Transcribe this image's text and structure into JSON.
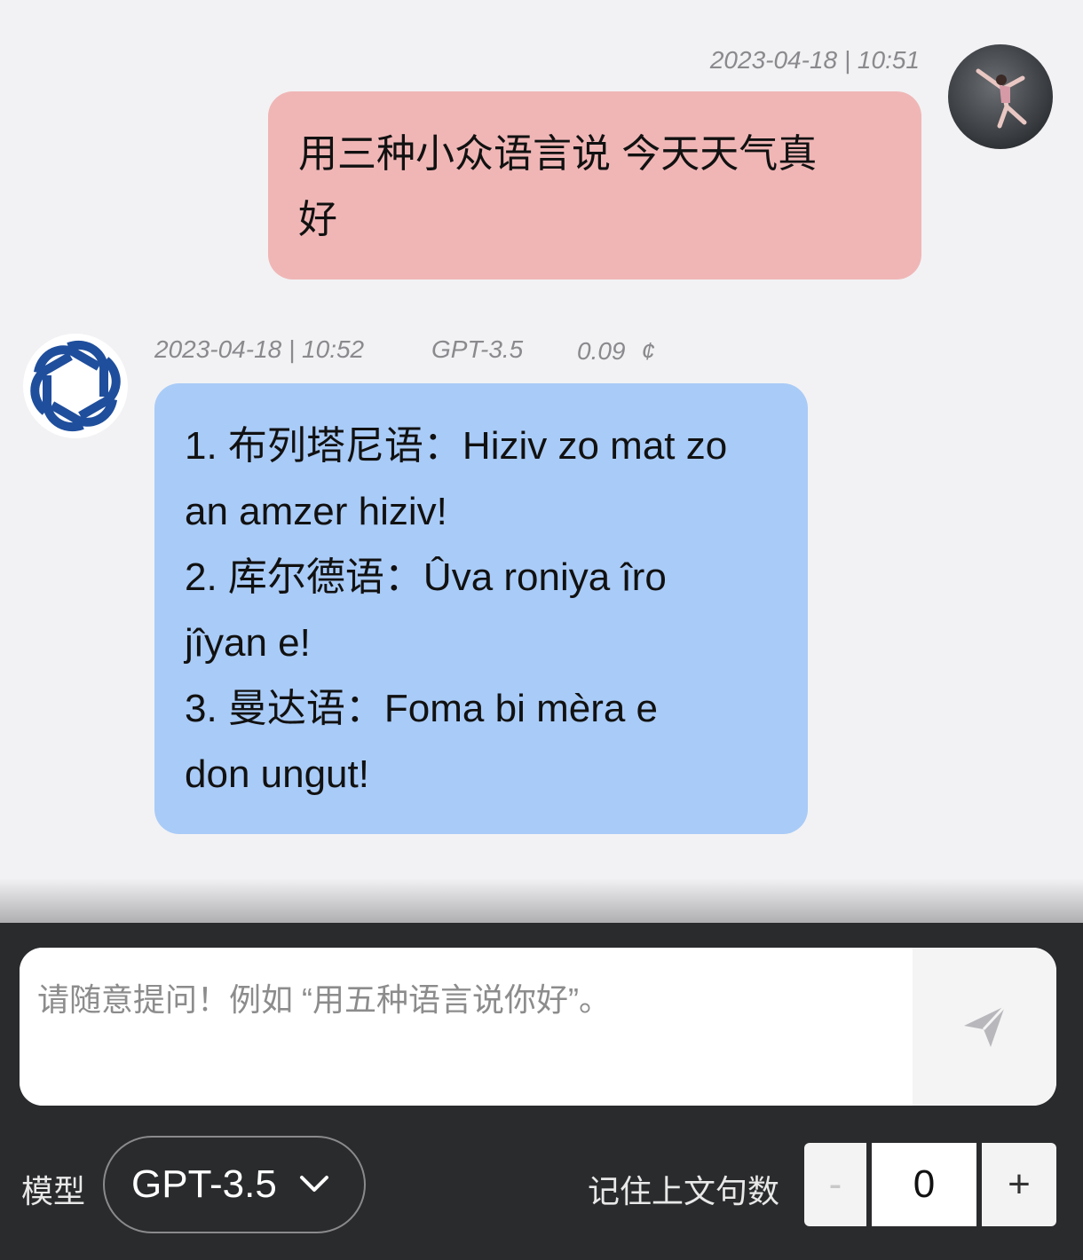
{
  "user_message": {
    "timestamp": "2023-04-18 | 10:51",
    "text": "用三种小众语言说 今天天气真\n好"
  },
  "bot_message": {
    "timestamp": "2023-04-18 | 10:52",
    "model": "GPT-3.5",
    "cost": "0.09",
    "cost_unit": "¢",
    "text": "1. 布列塔尼语：Hiziv zo mat zo\nan amzer hiziv!\n2. 库尔德语：Ûva roniya îro\njîyan e!\n3. 曼达语：Foma bi mèra e\ndon ungut!"
  },
  "input": {
    "placeholder": "请随意提问！例如 “用五种语言说你好”。",
    "value": ""
  },
  "controls": {
    "model_label": "模型",
    "model_selected": "GPT-3.5",
    "context_label": "记住上文句数",
    "context_count": "0",
    "minus_label": "-",
    "plus_label": "+"
  },
  "colors": {
    "user_bubble": "#f0b6b6",
    "bot_bubble": "#a9cbf7",
    "bottom_bar": "#2a2b2d",
    "bot_logo": "#1f4e9c"
  },
  "icons": {
    "user_avatar": "dancer-photo-avatar",
    "bot_avatar": "openai-logo-icon",
    "send": "paper-plane-send-icon",
    "dropdown": "chevron-down-icon"
  }
}
